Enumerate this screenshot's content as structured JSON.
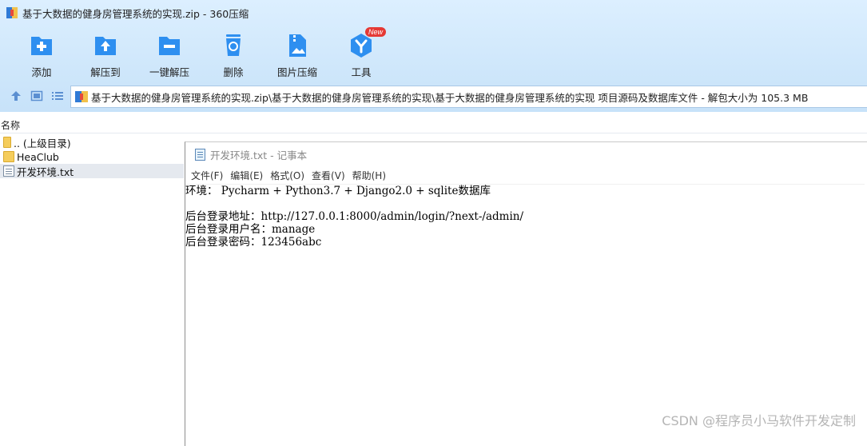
{
  "window": {
    "title": "基于大数据的健身房管理系统的实现.zip - 360压缩",
    "app_icon": "360-zip-icon"
  },
  "toolbar": {
    "items": [
      {
        "label": "添加",
        "icon": "add-file-icon"
      },
      {
        "label": "解压到",
        "icon": "extract-to-icon"
      },
      {
        "label": "一键解压",
        "icon": "one-click-extract-icon"
      },
      {
        "label": "删除",
        "icon": "recycle-bin-icon"
      },
      {
        "label": "图片压缩",
        "icon": "image-compress-icon"
      },
      {
        "label": "工具",
        "icon": "tools-icon",
        "badge": "New"
      }
    ]
  },
  "address": {
    "path": "基于大数据的健身房管理系统的实现.zip\\基于大数据的健身房管理系统的实现\\基于大数据的健身房管理系统的实现  项目源码及数据库文件 - 解包大小为 105.3 MB"
  },
  "file_list": {
    "column_name": "名称",
    "rows": [
      {
        "name": ".. (上级目录)",
        "type": "parent-folder"
      },
      {
        "name": "HeaClub",
        "type": "folder"
      },
      {
        "name": "开发环境.txt",
        "type": "text-file",
        "selected": true
      }
    ]
  },
  "notepad": {
    "title": "开发环境.txt - 记事本",
    "menu": [
      "文件(F)",
      "编辑(E)",
      "格式(O)",
      "查看(V)",
      "帮助(H)"
    ],
    "content": "环境： Pycharm + Python3.7 + Django2.0 + sqlite数据库\n\n后台登录地址：http://127.0.0.1:8000/admin/login/?next-/admin/\n后台登录用户名：manage\n后台登录密码：123456abc"
  },
  "watermark": "CSDN @程序员小马软件开发定制",
  "colors": {
    "toolbar_bg": "#cfe7fb",
    "icon_blue": "#2e8ff0",
    "badge_red": "#e53935",
    "selection": "#e5e9ef"
  }
}
